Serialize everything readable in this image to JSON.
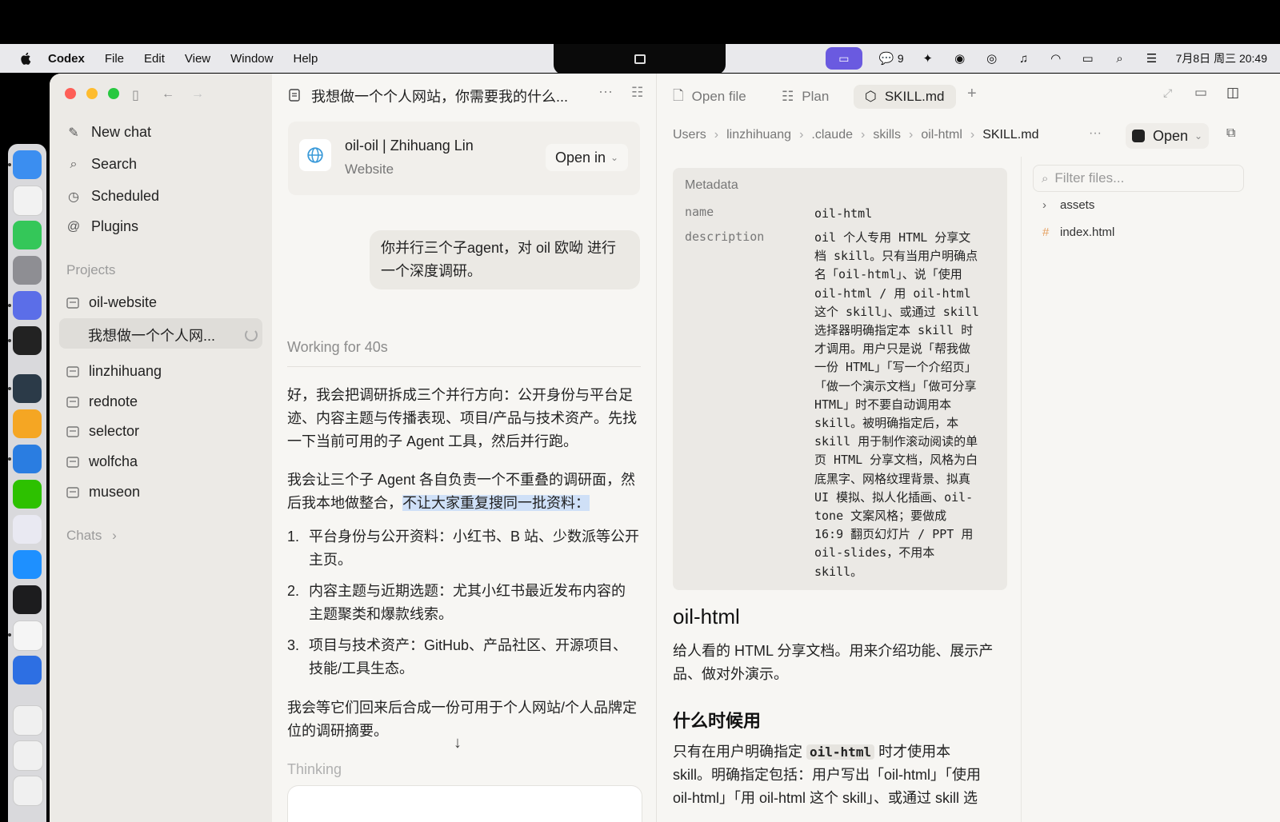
{
  "menubar": {
    "app": "Codex",
    "items": [
      "File",
      "Edit",
      "View",
      "Window",
      "Help"
    ],
    "wechat_count": "9",
    "datetime": "7月8日 周三  20:49"
  },
  "sidebar": {
    "nav": [
      {
        "label": "New chat",
        "icon": "compose-icon"
      },
      {
        "label": "Search",
        "icon": "search-icon"
      },
      {
        "label": "Scheduled",
        "icon": "clock-icon"
      },
      {
        "label": "Plugins",
        "icon": "at-icon"
      }
    ],
    "projects_label": "Projects",
    "projects": [
      "oil-website",
      "linzhihuang",
      "rednote",
      "selector",
      "wolfcha",
      "museon"
    ],
    "active_chat": "我想做一个个人网...",
    "chats_label": "Chats"
  },
  "center": {
    "title": "我想做一个个人网站，你需要我的什么...",
    "card": {
      "title": "oil-oil | Zhihuang Lin",
      "subtitle": "Website",
      "open_label": "Open in"
    },
    "user_message": "你并行三个子agent，对 oil 欧呦 进行一个深度调研。",
    "working": "Working for 40s",
    "para1": "好，我会把调研拆成三个并行方向：公开身份与平台足迹、内容主题与传播表现、项目/产品与技术资产。先找一下当前可用的子 Agent 工具，然后并行跑。",
    "para2_a": "我会让三个子 Agent 各自负责一个不重叠的调研面，然后我本地做整合，",
    "para2_hl": "不让大家重复搜同一批资料：",
    "list": [
      {
        "n": "1.",
        "text": "平台身份与公开资料：小红书、B 站、少数派等公开主页。"
      },
      {
        "n": "2.",
        "text": "内容主题与近期选题：尤其小红书最近发布内容的主题聚类和爆款线索。"
      },
      {
        "n": "3.",
        "text": "项目与技术资产：GitHub、产品社区、开源项目、技能/工具生态。"
      }
    ],
    "para3": "我会等它们回来后合成一份可用于个人网站/个人品牌定位的调研摘要。",
    "thinking": "Thinking"
  },
  "right": {
    "tabs": [
      {
        "label": "Open file",
        "icon": "file-icon"
      },
      {
        "label": "Plan",
        "icon": "plan-icon"
      },
      {
        "label": "SKILL.md",
        "icon": "skill-icon"
      }
    ],
    "breadcrumbs": [
      "Users",
      "linzhihuang",
      ".claude",
      "skills",
      "oil-html",
      "SKILL.md"
    ],
    "open_label": "Open",
    "metadata_label": "Metadata",
    "meta_name_key": "name",
    "meta_name_val": "oil-html",
    "meta_desc_key": "description",
    "meta_desc_lines": [
      "oil 个人专用 HTML 分享文",
      "档 skill。只有当用户明确点",
      "名「oil-html」、说「使用",
      "oil-html / 用 oil-html",
      "这个 skill」、或通过 skill",
      "选择器明确指定本 skill 时",
      "才调用。用户只是说「帮我做",
      "一份 HTML」「写一个介绍页」",
      "「做一个演示文档」「做可分享",
      "HTML」时不要自动调用本",
      "skill。被明确指定后，本",
      "skill 用于制作滚动阅读的单",
      "页 HTML 分享文档，风格为白",
      "底黑字、网格纹理背景、拟真",
      "UI 模拟、拟人化插画、oil-",
      "tone 文案风格；要做成",
      "16:9 翻页幻灯片 / PPT 用",
      "oil-slides，不用本",
      "skill。"
    ],
    "h1": "oil-html",
    "p1": "给人看的 HTML 分享文档。用来介绍功能、展示产品、做对外演示。",
    "h2": "什么时候用",
    "p2_a": "只有在用户明确指定 ",
    "p2_code": "oil-html",
    "p2_b": " 时才使用本",
    "p2_line2": "skill。明确指定包括：用户写出「oil-html」「使用",
    "p2_line3": "oil-html」「用 oil-html 这个 skill」、或通过 skill 选",
    "filter_placeholder": "Filter files...",
    "files": [
      {
        "name": "assets",
        "icon": "chevron-right-icon"
      },
      {
        "name": "index.html",
        "icon": "hash-icon"
      }
    ]
  }
}
